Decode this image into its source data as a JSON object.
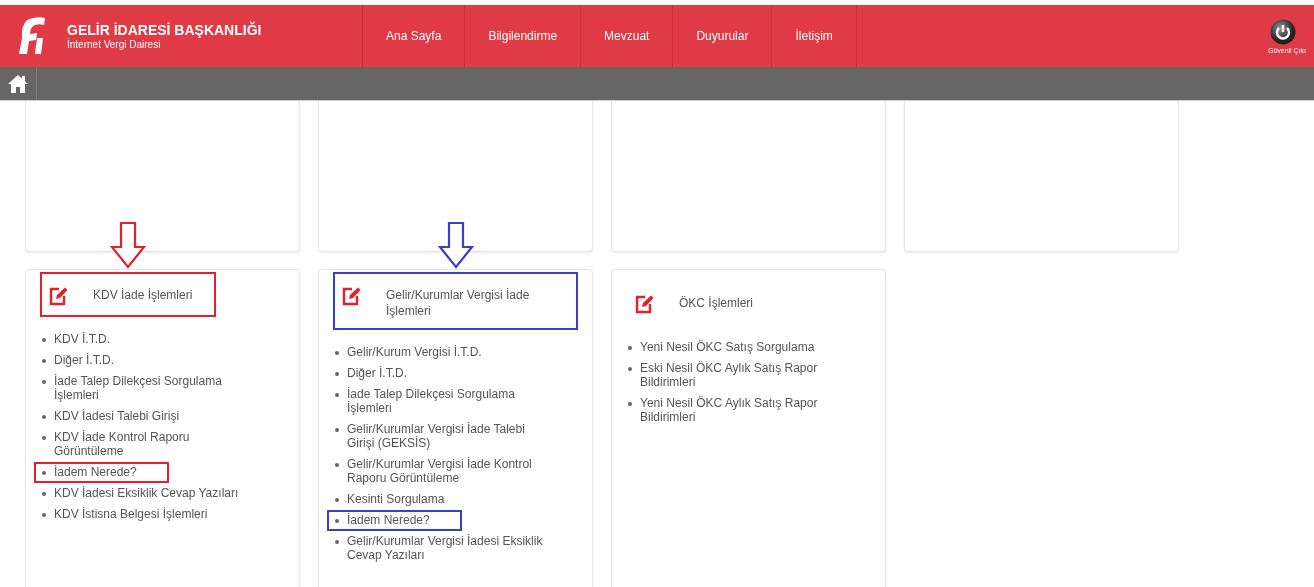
{
  "header": {
    "title": "GELİR İDARESİ BAŞKANLIĞI",
    "subtitle": "İnternet Vergi Dairesi",
    "nav": [
      {
        "label": "Ana Sayfa"
      },
      {
        "label": "Bilgilendirme"
      },
      {
        "label": "Mevzuat"
      },
      {
        "label": "Duyurular"
      },
      {
        "label": "İletişim"
      }
    ],
    "logout": {
      "label": "Güvenli Çıkı"
    }
  },
  "top_cards": [
    {
      "kind": "empty"
    },
    {
      "kind": "empty"
    },
    {
      "kind": "empty"
    },
    {
      "kind": "empty"
    }
  ],
  "cards": [
    {
      "title": "KDV İade İşlemleri",
      "color": "#e3202c",
      "items": [
        {
          "label": "KDV İ.T.D.",
          "highlighted": false
        },
        {
          "label": "Diğer İ.T.D.",
          "highlighted": false
        },
        {
          "label": "İade Talep Dilekçesi Sorgulama İşlemleri",
          "highlighted": false
        },
        {
          "label": "KDV İadesi Talebi Girişi",
          "highlighted": false
        },
        {
          "label": "KDV İade Kontrol Raporu Görüntüleme",
          "highlighted": false
        },
        {
          "label": "İadem Nerede?",
          "highlighted": true
        },
        {
          "label": "KDV İadesi Eksiklik Cevap Yazıları",
          "highlighted": false
        },
        {
          "label": "KDV İstisna Belgesi İşlemleri",
          "highlighted": false
        }
      ]
    },
    {
      "title": "Gelir/Kurumlar Vergisi İade İşlemleri",
      "color": "#3b3fc6",
      "items": [
        {
          "label": "Gelir/Kurum Vergisi İ.T.D.",
          "highlighted": false
        },
        {
          "label": "Diğer İ.T.D.",
          "highlighted": false
        },
        {
          "label": "İade Talep Dilekçesi Sorgulama İşlemleri",
          "highlighted": false
        },
        {
          "label": "Gelir/Kurumlar Vergisi İade Talebi Girişi (GEKSİS)",
          "highlighted": false
        },
        {
          "label": "Gelir/Kurumlar Vergisi İade Kontrol Raporu Görüntüleme",
          "highlighted": false
        },
        {
          "label": "Kesinti Sorgulama",
          "highlighted": false
        },
        {
          "label": "İadem Nerede?",
          "highlighted": true
        },
        {
          "label": "Gelir/Kurumlar Vergisi İadesi Eksiklik Cevap Yazıları",
          "highlighted": false
        }
      ]
    },
    {
      "title": "ÖKC İşlemleri",
      "items": [
        {
          "label": "Yeni Nesil ÖKC Satış Sorgulama",
          "highlighted": false
        },
        {
          "label": "Eski Nesil ÖKC Aylık Satış Rapor Bildirimleri",
          "highlighted": false
        },
        {
          "label": "Yeni Nesil ÖKC Aylık Satış Rapor Bildirimleri",
          "highlighted": false
        }
      ]
    }
  ]
}
